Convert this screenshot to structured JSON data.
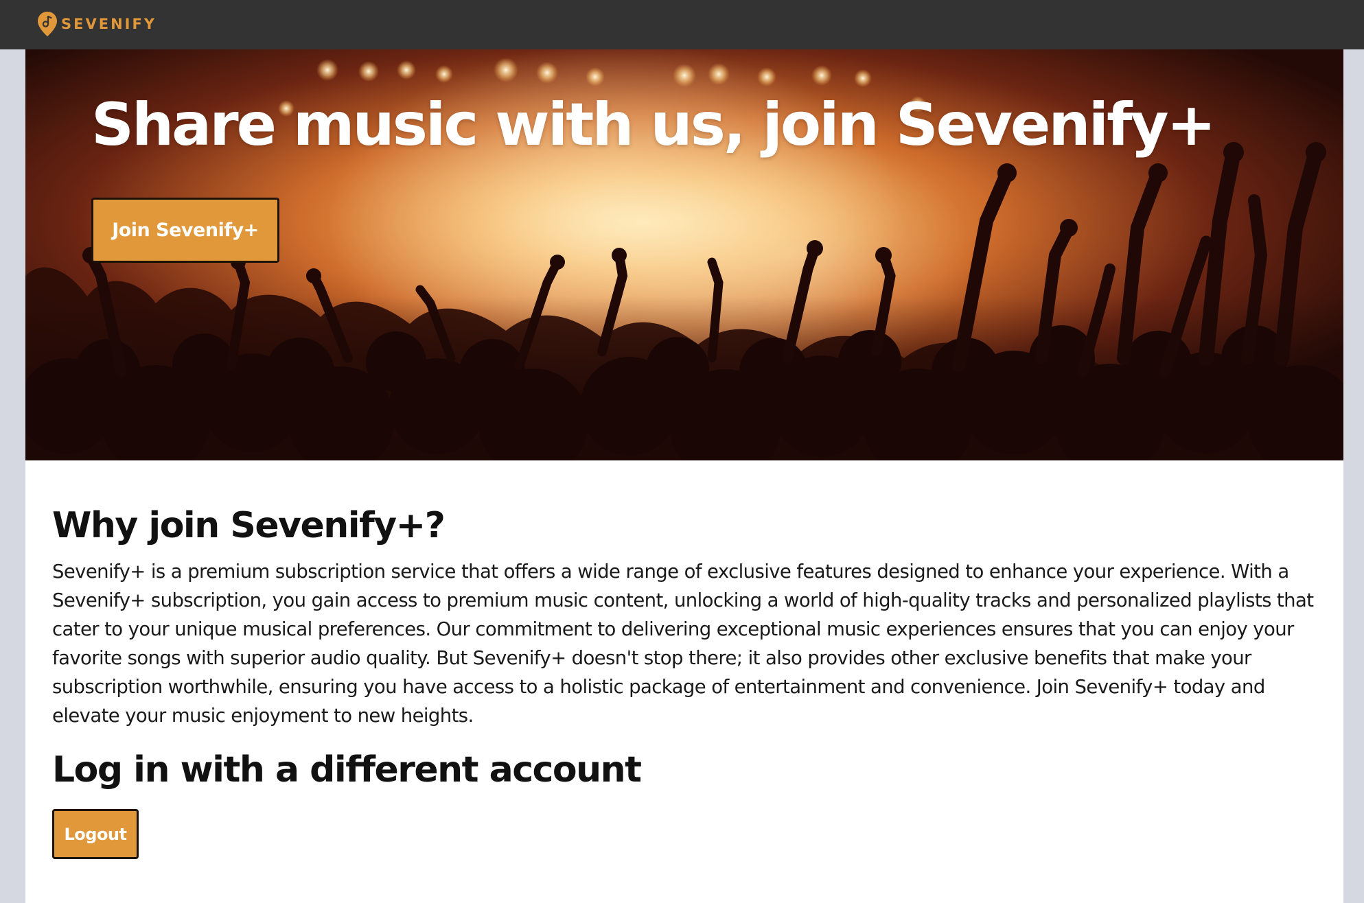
{
  "brand": {
    "name": "SEVENIFY",
    "icon": "music-note-pin-icon",
    "accent_color": "#e0983b",
    "topbar_color": "#333333"
  },
  "hero": {
    "title": "Share music with us, join Sevenify+",
    "button_label": "Join Sevenify+",
    "background": "concert-crowd-image"
  },
  "why": {
    "heading": "Why join Sevenify+?",
    "paragraph": "Sevenify+ is a premium subscription service that offers a wide range of exclusive features designed to enhance your experience. With a Sevenify+ subscription, you gain access to premium music content, unlocking a world of high-quality tracks and personalized playlists that cater to your unique musical preferences. Our commitment to delivering exceptional music experiences ensures that you can enjoy your favorite songs with superior audio quality. But Sevenify+ doesn't stop there; it also provides other exclusive benefits that make your subscription worthwhile, ensuring you have access to a holistic package of entertainment and convenience. Join Sevenify+ today and elevate your music enjoyment to new heights."
  },
  "account": {
    "heading": "Log in with a different account",
    "logout_label": "Logout"
  }
}
